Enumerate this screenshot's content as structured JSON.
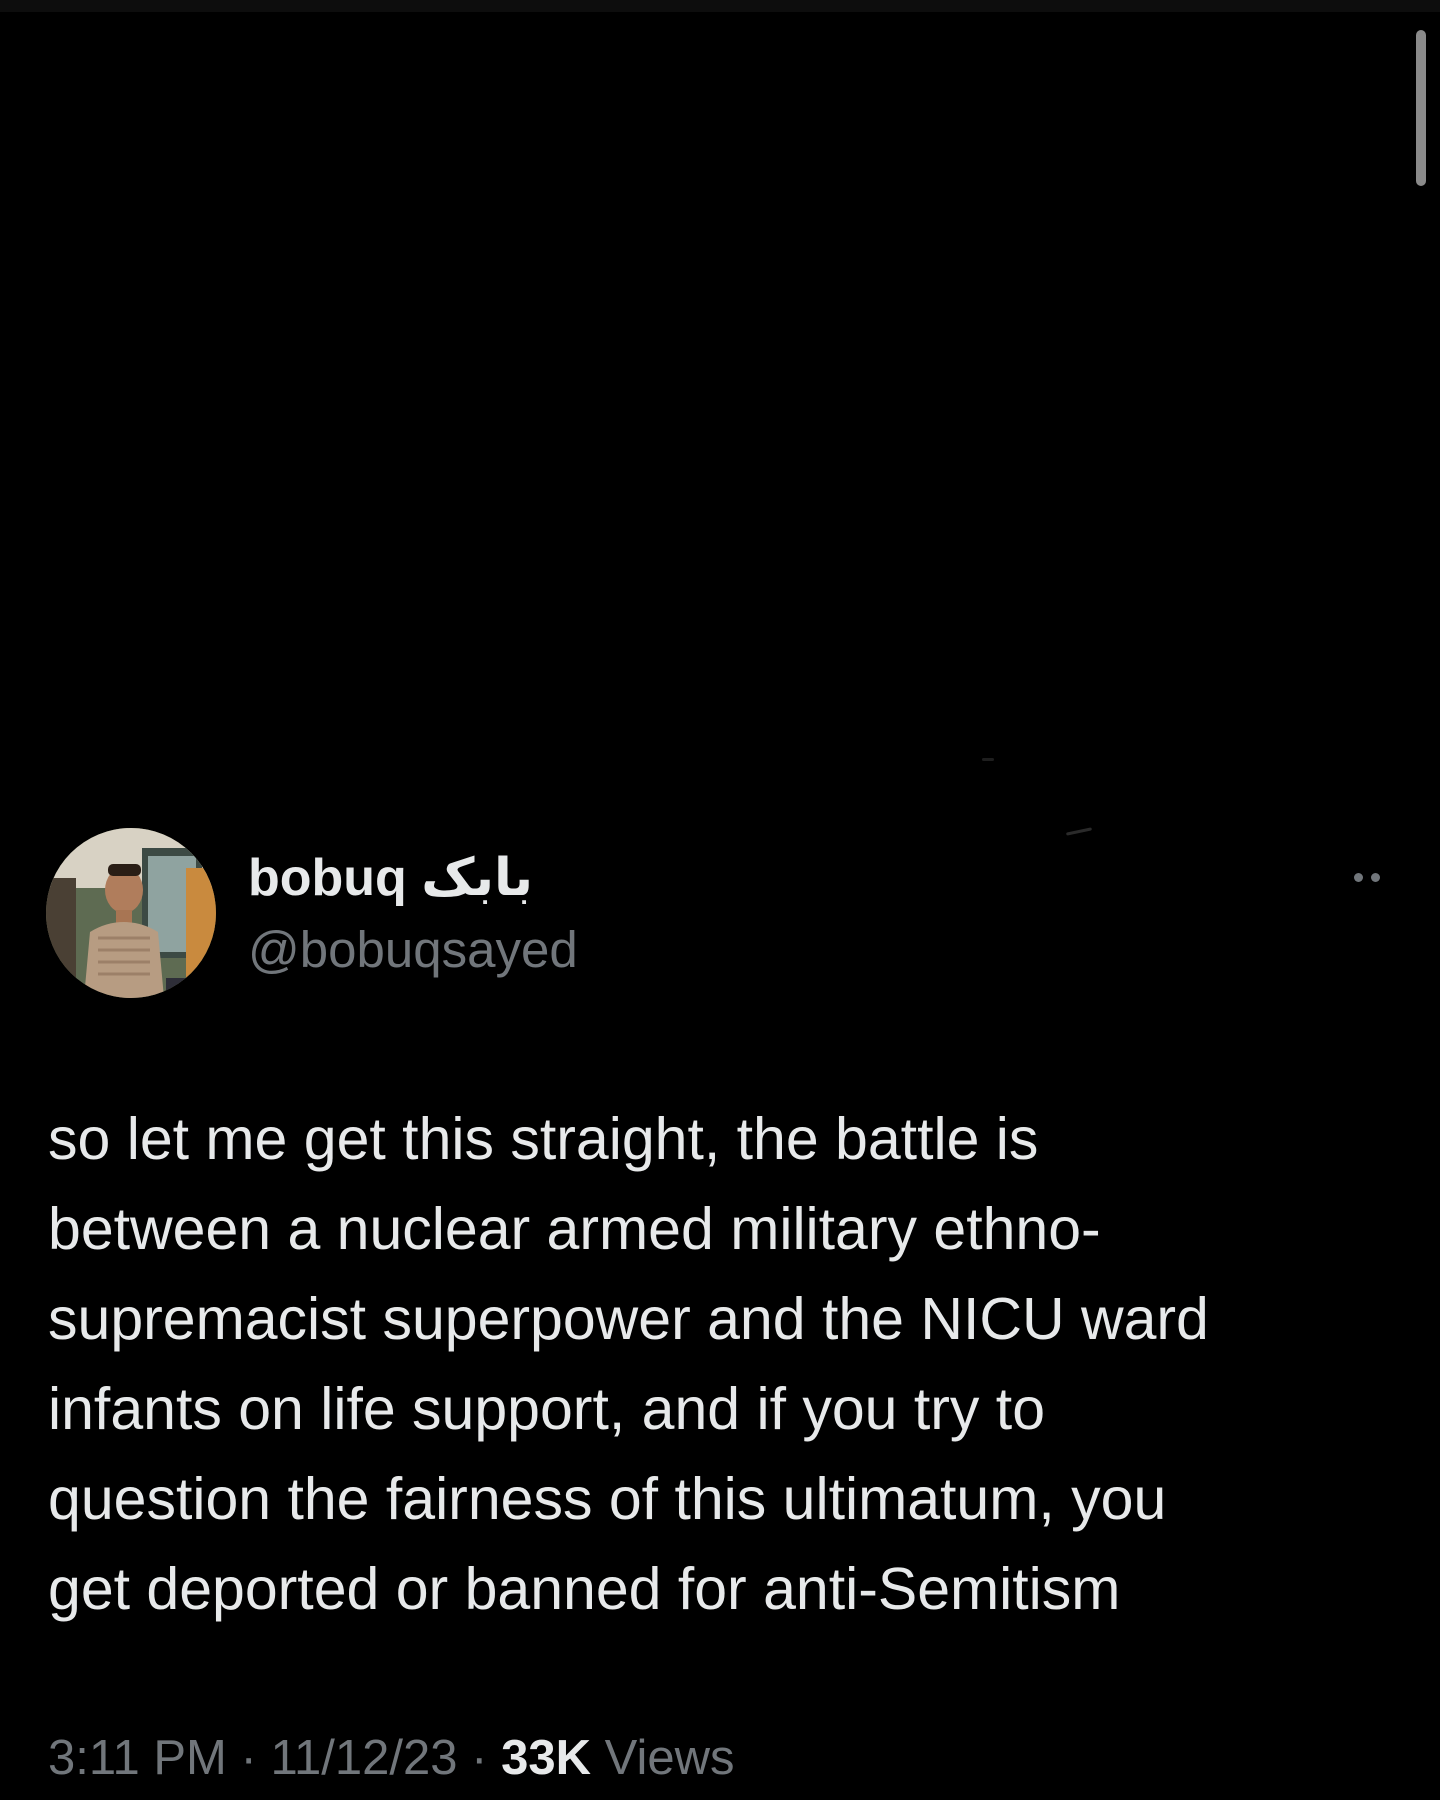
{
  "tweet": {
    "author": {
      "display_name": "bobuq بابک",
      "handle": "@bobuqsayed",
      "avatar": "avatar-photo"
    },
    "more_icon": "more-horizontal-icon",
    "text": "so let me get this straight, the battle is\nbetween a nuclear armed military ethno-\nsupremacist superpower and the NICU ward\ninfants on life support, and if you try to\nquestion the fairness of this ultimatum, you\nget deported or banned for anti-Semitism",
    "meta": {
      "time": "3:11 PM",
      "separator": "·",
      "date": "11/12/23",
      "views_count": "33K",
      "views_label": "Views"
    }
  },
  "colors": {
    "background": "#000000",
    "primary_text": "#e7e9ea",
    "secondary_text": "#71767b",
    "scrollbar": "#8a8a8a"
  }
}
